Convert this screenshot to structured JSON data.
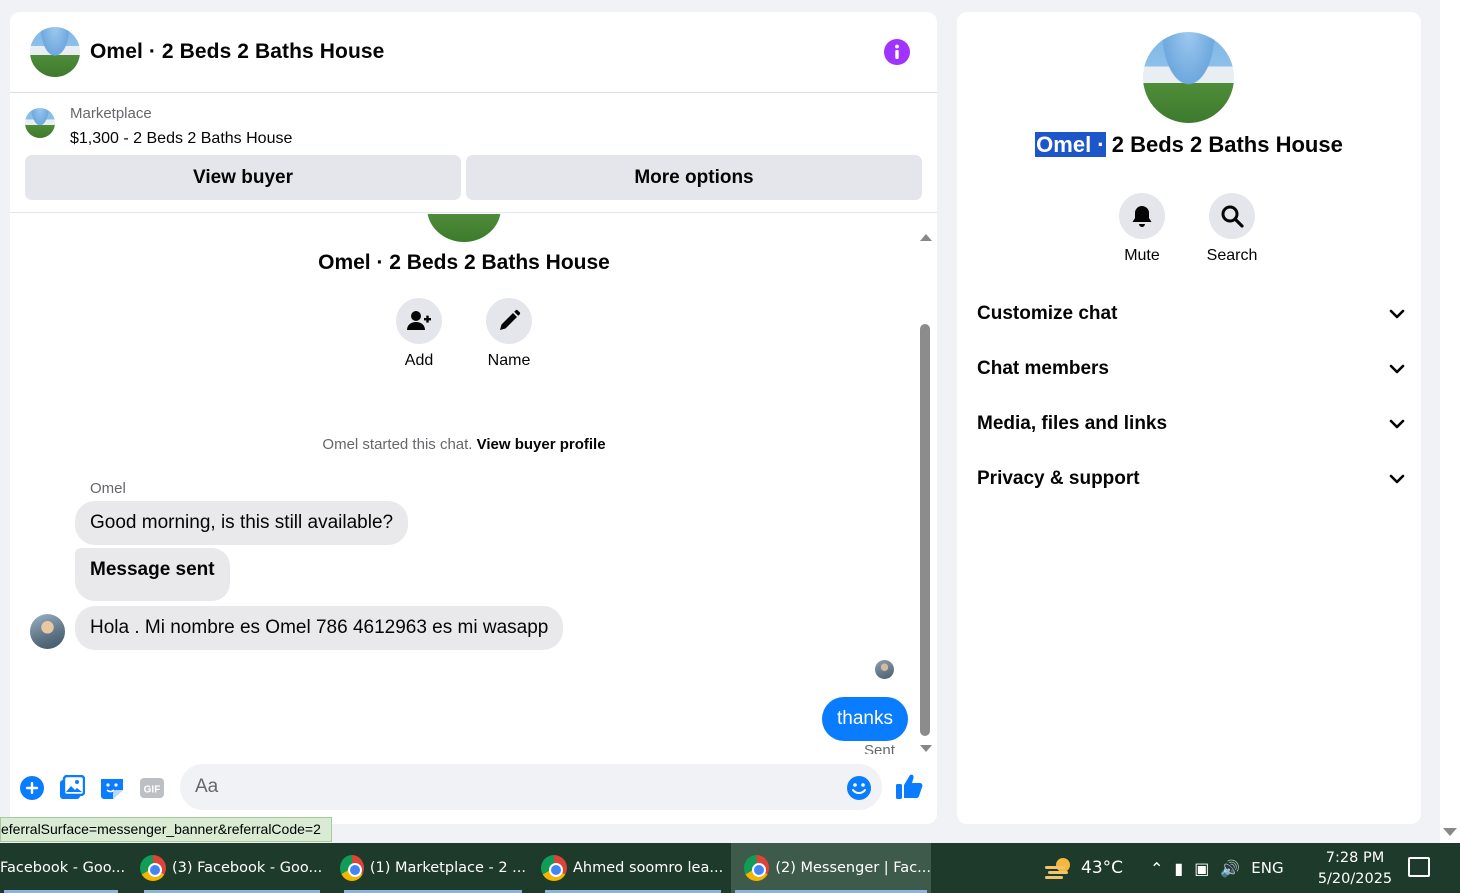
{
  "chat": {
    "title": "Omel · 2 Beds 2 Baths House",
    "marketplace_label": "Marketplace",
    "listing": "$1,300 - 2 Beds 2 Baths House",
    "view_buyer_label": "View buyer",
    "more_options_label": "More options",
    "intro_title": "Omel · 2 Beds 2 Baths House",
    "add_label": "Add",
    "name_label": "Name",
    "started_text": "Omel started this chat.",
    "view_buyer_profile": "View buyer profile",
    "sender_name": "Omel",
    "messages": [
      {
        "from": "Omel",
        "text": "Good morning, is this still available?"
      },
      {
        "from": "Omel",
        "text": "Message sent"
      },
      {
        "from": "Omel",
        "text": "Hola . Mi nombre es Omel 786 4612963 es mi wasapp"
      },
      {
        "from": "me",
        "text": "thanks"
      }
    ],
    "sent_status": "Sent",
    "input_placeholder": "Aa"
  },
  "info_panel": {
    "title_selected": "Omel ·",
    "title_rest": " 2 Beds 2 Baths House",
    "mute_label": "Mute",
    "search_label": "Search",
    "sections": [
      "Customize chat",
      "Chat members",
      "Media, files and links",
      "Privacy & support"
    ]
  },
  "status_url": "eferralSurface=messenger_banner&referralCode=2",
  "taskbar": {
    "tasks": [
      "Facebook - Goo...",
      "(3) Facebook - Goo...",
      "(1) Marketplace - 2 ...",
      "Ahmed soomro lea...",
      "(2) Messenger | Fac..."
    ],
    "temperature": "43°C",
    "language": "ENG",
    "time": "7:28 PM",
    "date": "5/20/2025"
  },
  "colors": {
    "accent_blue": "#0a7cff",
    "info_purple": "#a033ff",
    "selection": "#1c56c9"
  }
}
